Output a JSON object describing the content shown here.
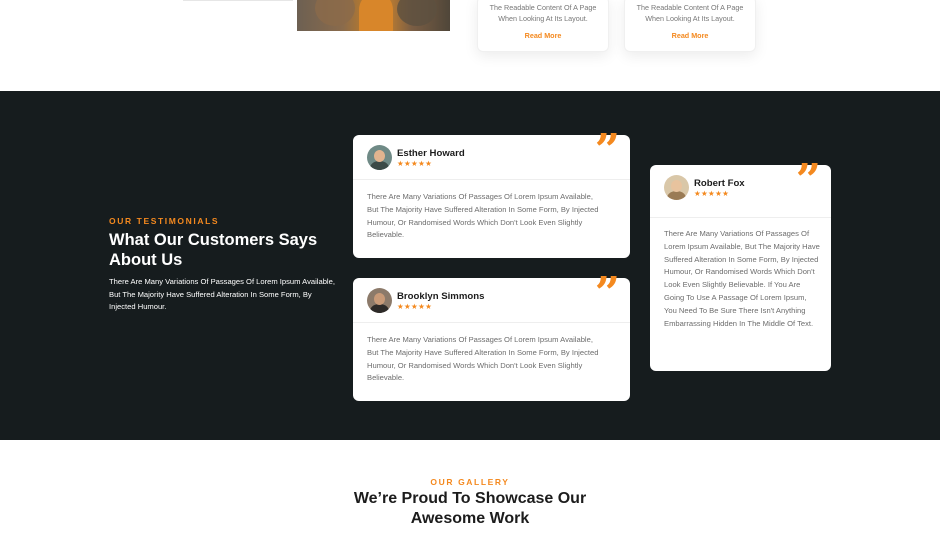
{
  "blog": {
    "cards": [
      {
        "text": "The Readable Content Of A Page When Looking At Its Layout.",
        "link": "Read More"
      },
      {
        "text": "The Readable Content Of A Page When Looking At Its Layout.",
        "link": "Read More"
      }
    ]
  },
  "testimonials": {
    "eyebrow": "OUR TESTIMONIALS",
    "title": "What Our Customers Says About Us",
    "lead": "There Are Many Variations Of Passages Of Lorem Ipsum Available, But The Majority Have Suffered Alteration In Some Form, By Injected Humour.",
    "quote_glyph": "”",
    "items": [
      {
        "name": "Esther Howard",
        "stars": "★★★★★",
        "rating": 5,
        "text": "There Are Many Variations Of Passages Of Lorem Ipsum Available, But The Majority Have Suffered Alteration In Some Form, By Injected Humour, Or Randomised Words Which Don't Look Even Slightly Believable."
      },
      {
        "name": "Brooklyn Simmons",
        "stars": "★★★★★",
        "rating": 5,
        "text": "There Are Many Variations Of Passages Of Lorem Ipsum Available, But The Majority Have Suffered Alteration In Some Form, By Injected Humour, Or Randomised Words Which Don't Look Even Slightly Believable."
      },
      {
        "name": "Robert Fox",
        "stars": "★★★★★",
        "rating": 5,
        "text": "There Are Many Variations Of Passages Of Lorem Ipsum Available, But The Majority Have Suffered Alteration In Some Form, By Injected Humour, Or Randomised Words Which Don't Look Even Slightly Believable. If You Are Going To Use A Passage Of Lorem Ipsum, You Need To Be Sure There Isn't Anything Embarrassing Hidden In The Middle Of Text."
      }
    ]
  },
  "gallery": {
    "eyebrow": "OUR GALLERY",
    "title": "We’re Proud To Showcase Our Awesome Work"
  },
  "colors": {
    "accent": "#f4891f",
    "dark_bg": "#161c1e",
    "card_bg": "#ffffff"
  },
  "icons": [
    "quote-icon",
    "star-icon"
  ]
}
